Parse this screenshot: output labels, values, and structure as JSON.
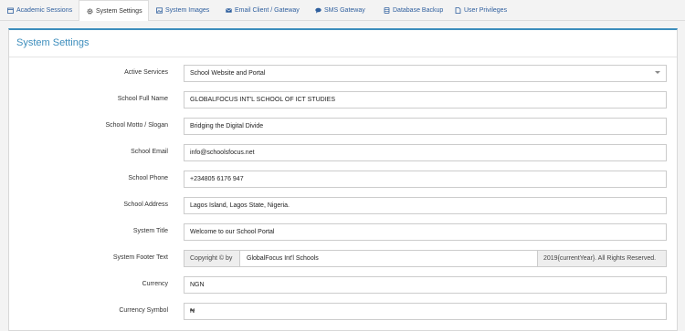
{
  "tabs": [
    {
      "label": "Academic Sessions",
      "icon": "calendar-icon"
    },
    {
      "label": "System Settings",
      "icon": "gear-icon",
      "active": true
    },
    {
      "label": "System Images",
      "icon": "image-icon"
    },
    {
      "label": "Email Client / Gateway",
      "icon": "envelope-icon"
    },
    {
      "label": "SMS Gateway",
      "icon": "chat-icon"
    },
    {
      "label": "Database Backup",
      "icon": "database-icon"
    },
    {
      "label": "User Privileges",
      "icon": "file-icon"
    }
  ],
  "panel": {
    "title": "System Settings"
  },
  "form": {
    "active_services": {
      "label": "Active Services",
      "value": "School Website and Portal"
    },
    "school_full_name": {
      "label": "School Full Name",
      "value": "GLOBALFOCUS INT'L SCHOOL OF ICT STUDIES"
    },
    "school_motto": {
      "label": "School Motto / Slogan",
      "value": "Bridging the Digital Divide"
    },
    "school_email": {
      "label": "School Email",
      "value": "info@schoolsfocus.net"
    },
    "school_phone": {
      "label": "School Phone",
      "value": "+234805 6176 947"
    },
    "school_address": {
      "label": "School Address",
      "value": "Lagos Island, Lagos State, Nigeria."
    },
    "system_title": {
      "label": "System Title",
      "value": "Welcome to our School Portal"
    },
    "system_footer": {
      "label": "System Footer Text",
      "prefix": "Copyright © by",
      "value": "GlobalFocus Int'l Schools",
      "suffix": "2019{currentYear}. All Rights Reserved."
    },
    "currency": {
      "label": "Currency",
      "value": "NGN"
    },
    "currency_symbol": {
      "label": "Currency Symbol",
      "value": "₦"
    }
  }
}
